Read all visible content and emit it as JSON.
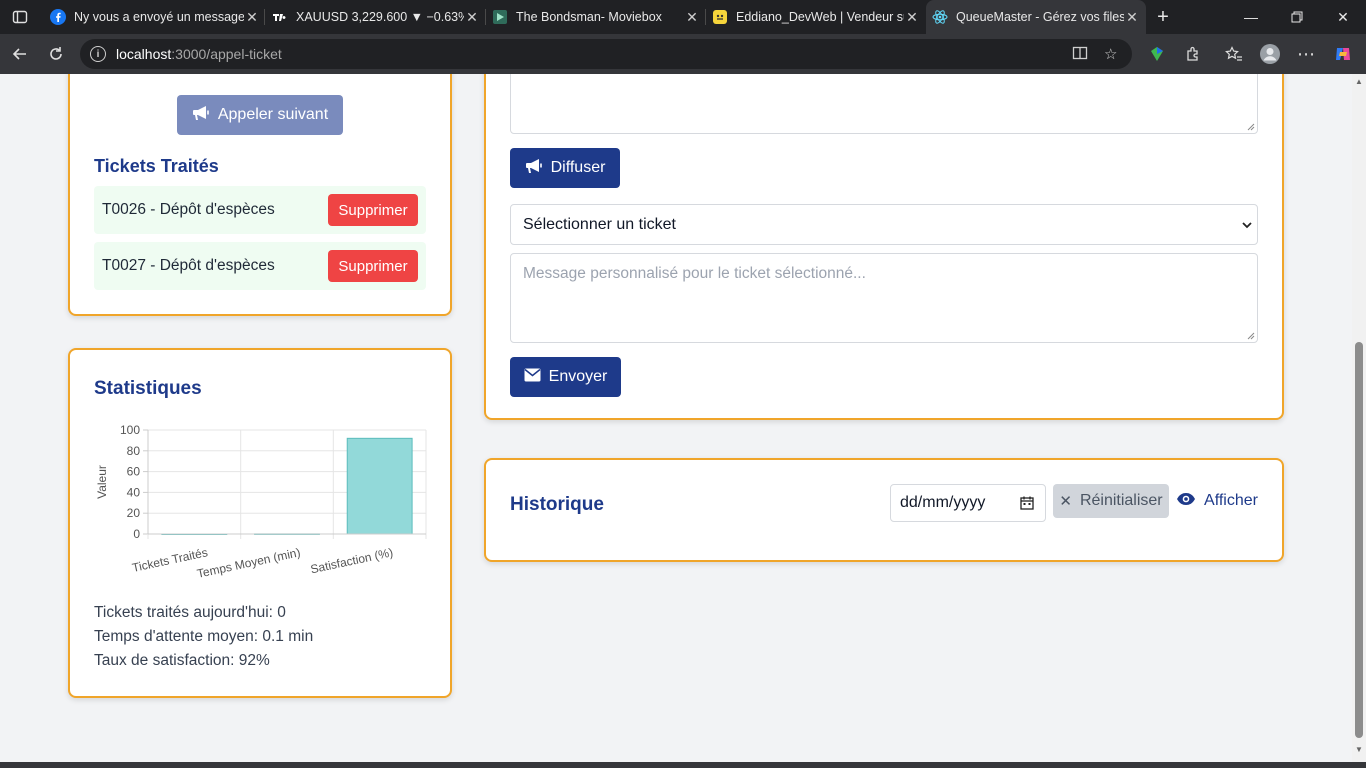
{
  "browser": {
    "tabs": [
      {
        "title": "Ny vous a envoyé un message",
        "icon": "facebook-icon"
      },
      {
        "title": "XAUUSD 3,229.600 ▼ −0.63%",
        "icon": "tradingview-icon"
      },
      {
        "title": "The Bondsman- Moviebox",
        "icon": "moviebox-icon"
      },
      {
        "title": "Eddiano_DevWeb | Vendeur su",
        "icon": "fiverr-icon"
      },
      {
        "title": "QueueMaster - Gérez vos files",
        "icon": "react-icon"
      }
    ],
    "url_host": "localhost",
    "url_path": ":3000/appel-ticket"
  },
  "left_panel": {
    "call_next_label": "Appeler suivant",
    "treated_title": "Tickets Traités",
    "treated_tickets": [
      {
        "label": "T0026 - Dépôt d'espèces",
        "action": "Supprimer"
      },
      {
        "label": "T0027 - Dépôt d'espèces",
        "action": "Supprimer"
      }
    ]
  },
  "stats": {
    "title": "Statistiques",
    "lines": [
      "Tickets traités aujourd'hui: 0",
      "Temps d'attente moyen: 0.1 min",
      "Taux de satisfaction: 92%"
    ]
  },
  "chart_data": {
    "type": "bar",
    "categories": [
      "Tickets Traités",
      "Temps Moyen (min)",
      "Satisfaction (%)"
    ],
    "values": [
      0,
      0.1,
      92
    ],
    "ylabel": "Valeur",
    "ylim": [
      0,
      100
    ],
    "yticks": [
      0,
      20,
      40,
      60,
      80,
      100
    ],
    "grid": true,
    "bar_color": "#92d9d9",
    "bar_border": "#5bbcbc"
  },
  "broadcast": {
    "diffuse_label": "Diffuser",
    "select_value": "Sélectionner un ticket",
    "custom_message_placeholder": "Message personnalisé pour le ticket sélectionné...",
    "send_label": "Envoyer"
  },
  "history": {
    "title": "Historique",
    "date_placeholder": "dd/mm/yyyy",
    "reset_label": "Réinitialiser",
    "show_label": "Afficher"
  }
}
